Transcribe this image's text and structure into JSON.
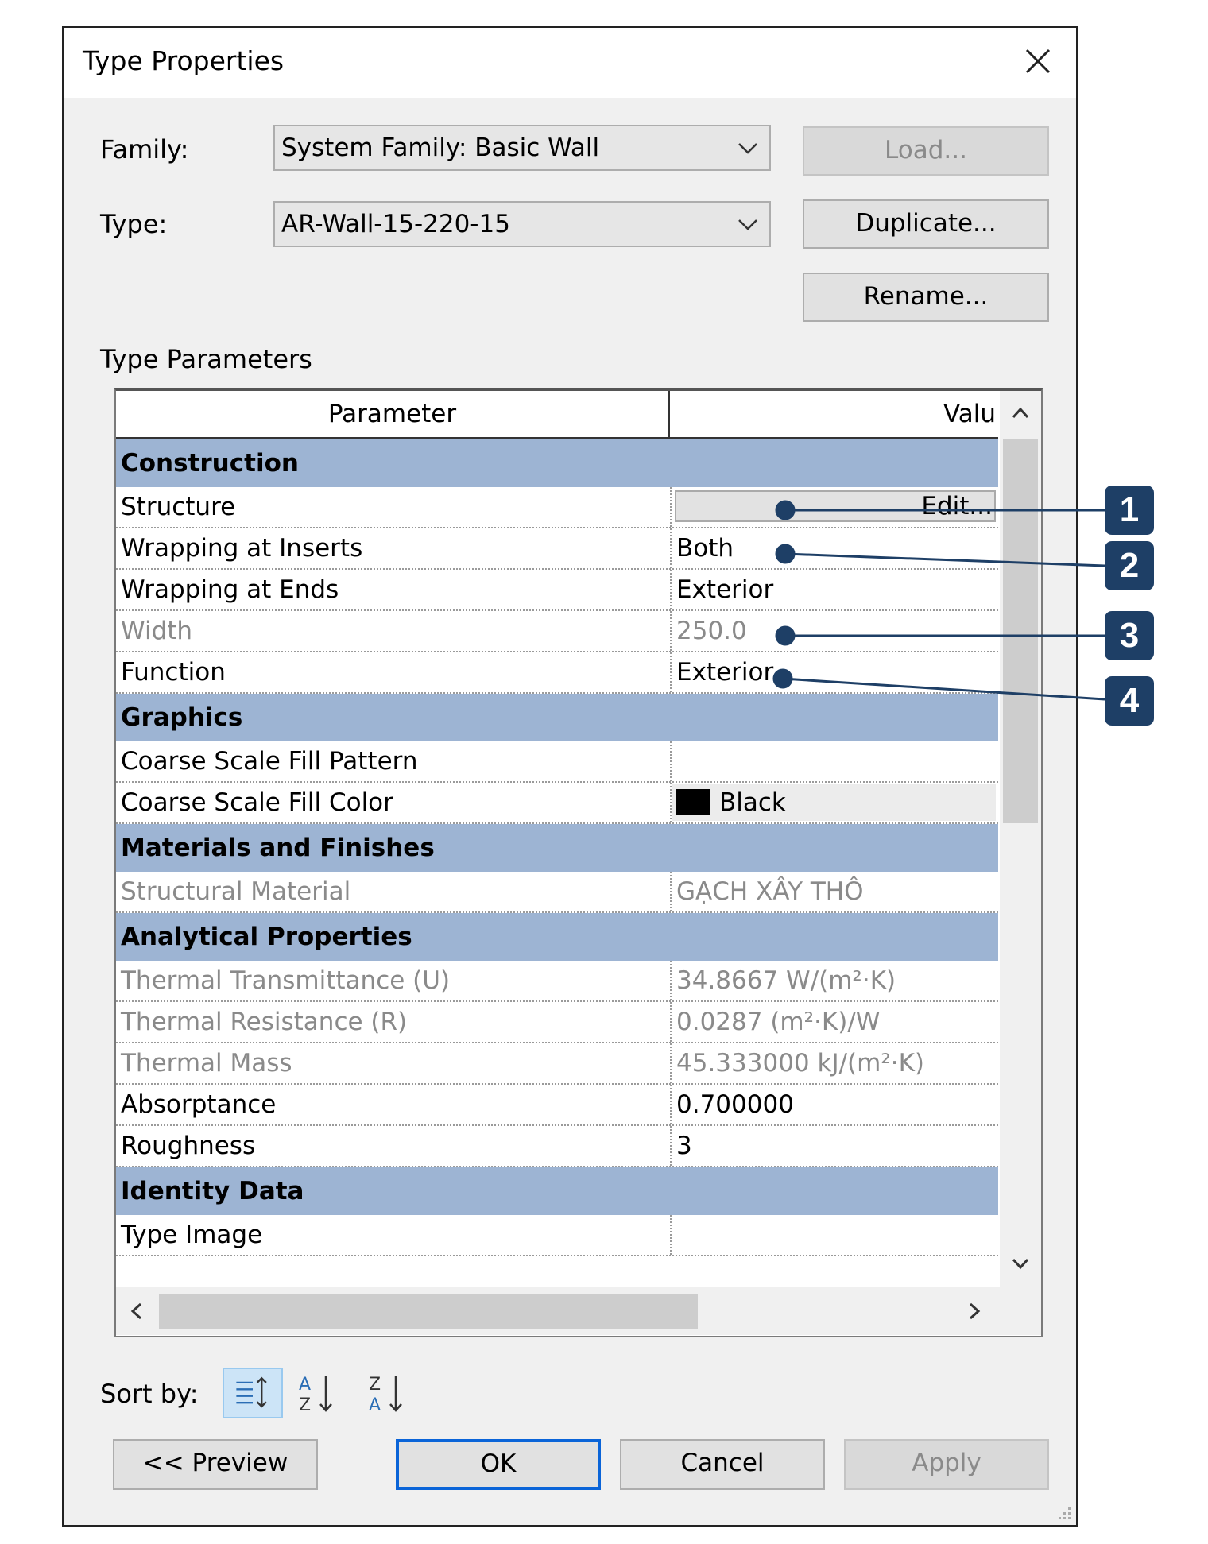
{
  "window": {
    "title": "Type Properties"
  },
  "family": {
    "label": "Family:",
    "value": "System Family: Basic Wall"
  },
  "type": {
    "label": "Type:",
    "value": "AR-Wall-15-220-15"
  },
  "buttons": {
    "load": "Load...",
    "duplicate": "Duplicate...",
    "rename": "Rename..."
  },
  "section_label": "Type Parameters",
  "grid": {
    "header": {
      "parameter": "Parameter",
      "value": "Valu"
    },
    "groups": {
      "construction": "Construction",
      "graphics": "Graphics",
      "materials": "Materials and Finishes",
      "analytical": "Analytical Properties",
      "identity": "Identity Data"
    },
    "rows": {
      "structure": {
        "param": "Structure",
        "value": "Edit..."
      },
      "wrapping_inserts": {
        "param": "Wrapping at Inserts",
        "value": "Both"
      },
      "wrapping_ends": {
        "param": "Wrapping at Ends",
        "value": "Exterior"
      },
      "width": {
        "param": "Width",
        "value": "250.0"
      },
      "function": {
        "param": "Function",
        "value": "Exterior"
      },
      "coarse_pattern": {
        "param": "Coarse Scale Fill Pattern",
        "value": ""
      },
      "coarse_color": {
        "param": "Coarse Scale Fill Color",
        "value": "Black"
      },
      "structural_material": {
        "param": "Structural Material",
        "value": "GẠCH XÂY THÔ"
      },
      "thermal_u": {
        "param": "Thermal Transmittance (U)",
        "value": "34.8667 W/(m²·K)"
      },
      "thermal_r": {
        "param": "Thermal Resistance (R)",
        "value": "0.0287 (m²·K)/W"
      },
      "thermal_mass": {
        "param": "Thermal Mass",
        "value": "45.333000 kJ/(m²·K)"
      },
      "absorptance": {
        "param": "Absorptance",
        "value": "0.700000"
      },
      "roughness": {
        "param": "Roughness",
        "value": "3"
      },
      "type_image": {
        "param": "Type Image",
        "value": ""
      }
    }
  },
  "sort": {
    "label": "Sort by:"
  },
  "footer": {
    "preview": "<< Preview",
    "ok": "OK",
    "cancel": "Cancel",
    "apply": "Apply"
  },
  "callouts": [
    "1",
    "2",
    "3",
    "4"
  ],
  "colors": {
    "group_header": "#9db4d3",
    "badge": "#1e3f66",
    "default_button_border": "#0a64d8"
  }
}
